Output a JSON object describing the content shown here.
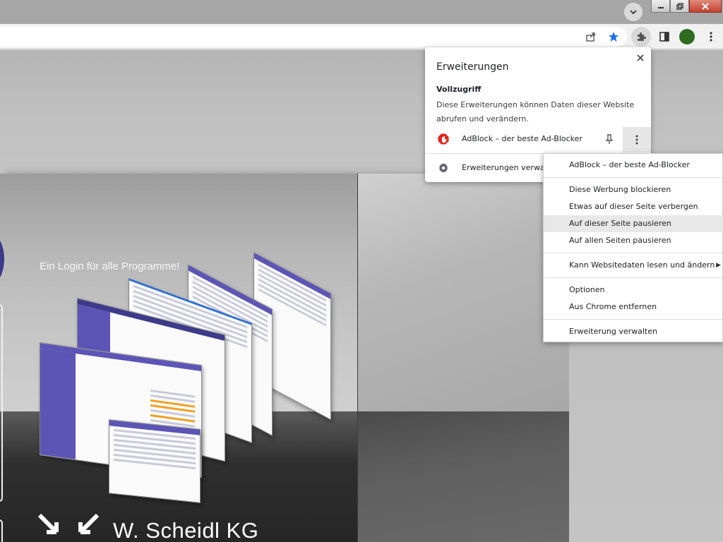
{
  "browser": {
    "window_buttons": [
      "minimize",
      "restore",
      "close"
    ],
    "toolbar_icons": [
      "share-icon",
      "bookmark-star-icon",
      "extensions-puzzle-icon",
      "side-panel-icon",
      "profile-avatar",
      "menu-kebab-icon"
    ],
    "accent_color": "#1a73e8",
    "avatar_color": "#2e6b1f"
  },
  "page": {
    "tagline": "Ein Login für alle Programme!",
    "company": "W. Scheidl KG"
  },
  "extensions_panel": {
    "title": "Erweiterungen",
    "section_title": "Vollzugriff",
    "section_desc": "Diese Erweiterungen können Daten dieser Website abrufen und verändern.",
    "extension_name": "AdBlock – der beste Ad-Blocker",
    "manage_label": "Erweiterungen verwal"
  },
  "context_menu": {
    "header": "AdBlock – der beste Ad-Blocker",
    "items": [
      "Diese Werbung blockieren",
      "Etwas auf dieser Seite verbergen",
      "Auf dieser Seite pausieren",
      "Auf allen Seiten pausieren",
      "Kann Websitedaten lesen und ändern",
      "Optionen",
      "Aus Chrome entfernen",
      "Erweiterung verwalten"
    ],
    "highlighted_item": "Auf dieser Seite pausieren"
  }
}
